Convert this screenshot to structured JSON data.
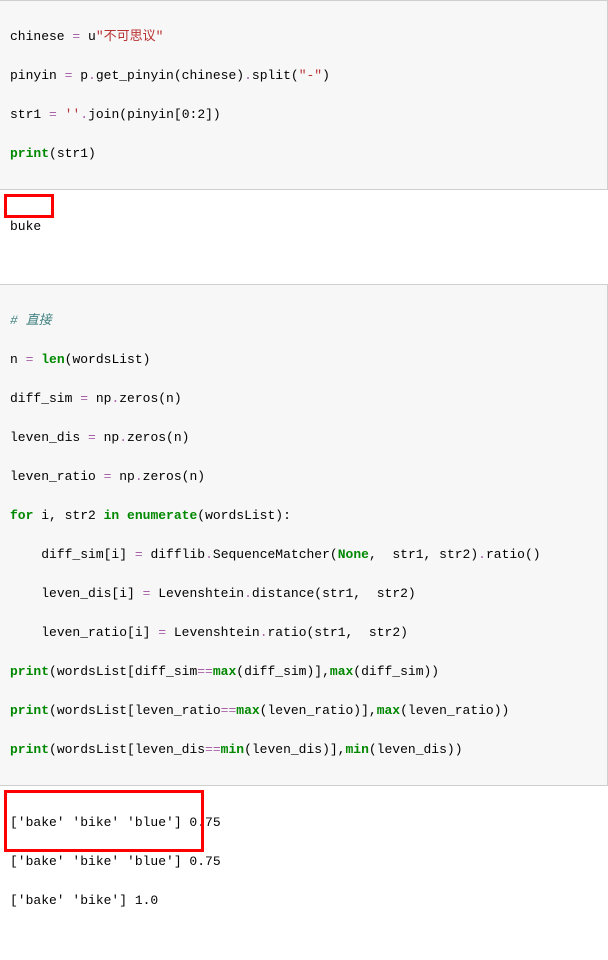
{
  "cell1": {
    "l1": {
      "t1": "chinese ",
      "op": "=",
      "t2": " u",
      "str": "\"不可思议\""
    },
    "l2": {
      "t1": "pinyin ",
      "op": "=",
      "t2": " p",
      "dot1": ".",
      "fn1": "get_pinyin(chinese)",
      "dot2": ".",
      "fn2": "split(",
      "str": "\"-\"",
      "t3": ")"
    },
    "l3": {
      "t1": "str1 ",
      "op": "=",
      "t2": " ",
      "str": "''",
      "dot": ".",
      "fn": "join(pinyin[",
      "n0": "0",
      "c": ":",
      "n2": "2",
      "t3": "])"
    },
    "l4": {
      "kw": "print",
      "t": "(str1)"
    }
  },
  "out1": {
    "line": "buke"
  },
  "cell2": {
    "l1": {
      "cm": "# 直接"
    },
    "l2": {
      "t1": "n ",
      "op": "=",
      "t2": " ",
      "kw": "len",
      "t3": "(wordsList)"
    },
    "l3": {
      "t1": "diff_sim ",
      "op": "=",
      "t2": " np",
      "dot": ".",
      "fn": "zeros(n)"
    },
    "l4": {
      "t1": "leven_dis ",
      "op": "=",
      "t2": " np",
      "dot": ".",
      "fn": "zeros(n)"
    },
    "l5": {
      "t1": "leven_ratio ",
      "op": "=",
      "t2": " np",
      "dot": ".",
      "fn": "zeros(n)"
    },
    "l6": {
      "kw1": "for",
      "t1": " i, str2 ",
      "kw2": "in",
      "t2": " ",
      "kw3": "enumerate",
      "t3": "(wordsList):"
    },
    "l7": {
      "pad": "    ",
      "t1": "diff_sim[i] ",
      "op": "=",
      "t2": " difflib",
      "dot1": ".",
      "fn1": "SequenceMatcher(",
      "none": "None",
      "t3": ",  str1, str2)",
      "dot2": ".",
      "fn2": "ratio()"
    },
    "l8": {
      "pad": "    ",
      "t1": "leven_dis[i] ",
      "op": "=",
      "t2": " Levenshtein",
      "dot": ".",
      "fn": "distance(str1,  str2)"
    },
    "l9": {
      "pad": "    ",
      "t1": "leven_ratio[i] ",
      "op": "=",
      "t2": " Levenshtein",
      "dot": ".",
      "fn": "ratio(str1,  str2)"
    },
    "l10": {
      "kw": "print",
      "t1": "(wordsList[diff_sim",
      "op1": "==",
      "fn1": "max",
      "t2": "(diff_sim)],",
      "fn2": "max",
      "t3": "(diff_sim))"
    },
    "l11": {
      "kw": "print",
      "t1": "(wordsList[leven_ratio",
      "op1": "==",
      "fn1": "max",
      "t2": "(leven_ratio)],",
      "fn2": "max",
      "t3": "(leven_ratio))"
    },
    "l12": {
      "kw": "print",
      "t1": "(wordsList[leven_dis",
      "op1": "==",
      "fn1": "min",
      "t2": "(leven_dis)],",
      "fn2": "min",
      "t3": "(leven_dis))"
    }
  },
  "out2": {
    "l1": "['bake' 'bike' 'blue'] 0.75",
    "l2": "['bake' 'bike' 'blue'] 0.75",
    "l3": "['bake' 'bike'] 1.0"
  }
}
